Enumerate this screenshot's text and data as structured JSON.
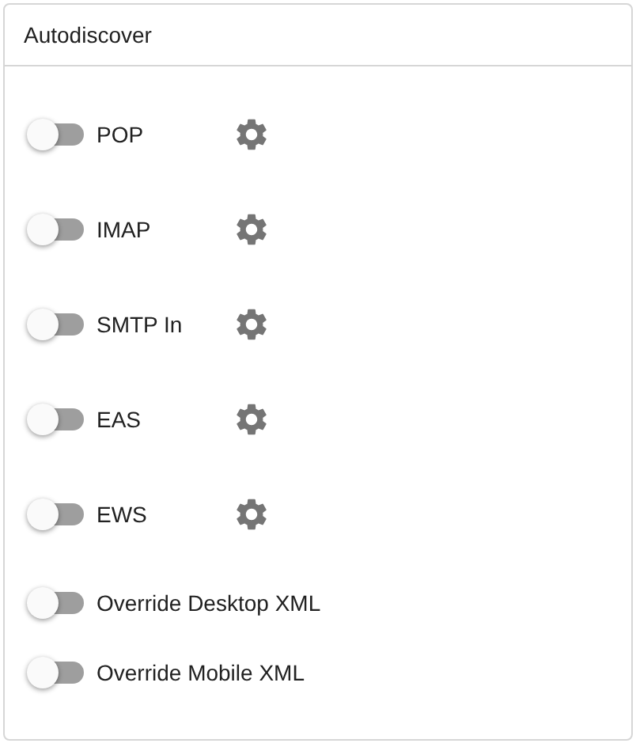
{
  "card": {
    "title": "Autodiscover"
  },
  "rows": [
    {
      "label": "POP",
      "on": false,
      "kind": "settings"
    },
    {
      "label": "IMAP",
      "on": false,
      "kind": "settings"
    },
    {
      "label": "SMTP In",
      "on": false,
      "kind": "settings"
    },
    {
      "label": "EAS",
      "on": false,
      "kind": "settings"
    },
    {
      "label": "EWS",
      "on": false,
      "kind": "settings"
    },
    {
      "label": "Override Desktop XML",
      "on": false,
      "kind": "plain"
    },
    {
      "label": "Override Mobile XML",
      "on": false,
      "kind": "plain"
    }
  ]
}
